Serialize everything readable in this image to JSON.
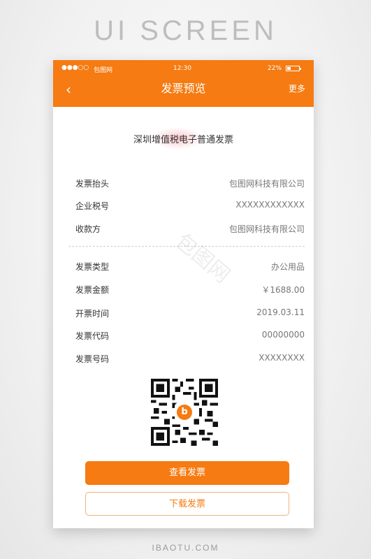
{
  "heading": "UI SCREEN",
  "status": {
    "signal": "●●●○○",
    "carrier": "包图网",
    "time": "12:30",
    "battery_pct": "22%"
  },
  "topbar": {
    "back_icon": "‹",
    "title": "发票预览",
    "more": "更多"
  },
  "invoice": {
    "doc_title": "深圳增值税电子普通发票",
    "rows_top": [
      {
        "label": "发票抬头",
        "value": "包图网科技有限公司"
      },
      {
        "label": "企业税号",
        "value": "XXXXXXXXXXXX"
      },
      {
        "label": "收款方",
        "value": "包图网科技有限公司"
      }
    ],
    "rows_bottom": [
      {
        "label": "发票类型",
        "value": "办公用品"
      },
      {
        "label": "发票金额",
        "value": "￥1688.00"
      },
      {
        "label": "开票时间",
        "value": "2019.03.11"
      },
      {
        "label": "发票代码",
        "value": "00000000"
      },
      {
        "label": "发票号码",
        "value": "XXXXXXXX"
      }
    ],
    "qr_logo": "b"
  },
  "buttons": {
    "view": "查看发票",
    "download": "下载发票"
  },
  "watermark": "包图网",
  "footer": "IBAOTU.COM",
  "colors": {
    "accent": "#f57b12"
  }
}
